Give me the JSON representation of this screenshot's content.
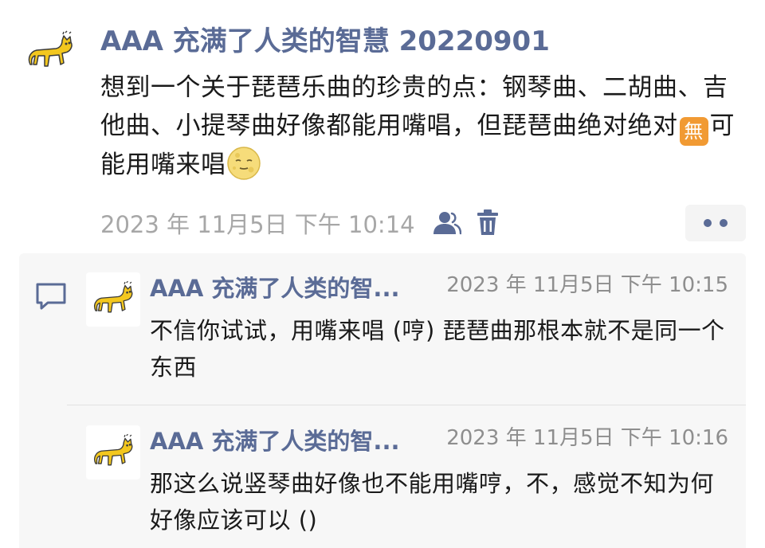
{
  "post": {
    "author": "AAA 充满了人类的智慧 20220901",
    "content_part1": "想到一个关于琵琶乐曲的珍贵的点：钢琴曲、二胡曲、吉他曲、小提琴曲好像都能用嘴唱，但琵琶曲绝对绝对",
    "emoji_badge": "無",
    "content_part2": "可能用嘴来唱",
    "time": "2023 年 11月5日 下午 10:14",
    "icons": [
      "cat-avatar",
      "people-icon",
      "trash-icon",
      "more-icon",
      "moon-face-emoji"
    ]
  },
  "comments": [
    {
      "author": "AAA 充满了人类的智...",
      "time": "2023 年 11月5日 下午 10:15",
      "text": "不信你试试，用嘴来唱 (哼) 琵琶曲那根本就不是同一个东西"
    },
    {
      "author": "AAA 充满了人类的智...",
      "time": "2023 年 11月5日 下午 10:16",
      "text": "那这么说竖琴曲好像也不能用嘴哼，不，感觉不知为何好像应该可以 ()"
    }
  ],
  "colors": {
    "author_name": "#5a6b96",
    "timestamp": "#a7a7a7",
    "comment_bg": "#f7f7f7",
    "emoji_badge_bg": "#f19a33"
  }
}
